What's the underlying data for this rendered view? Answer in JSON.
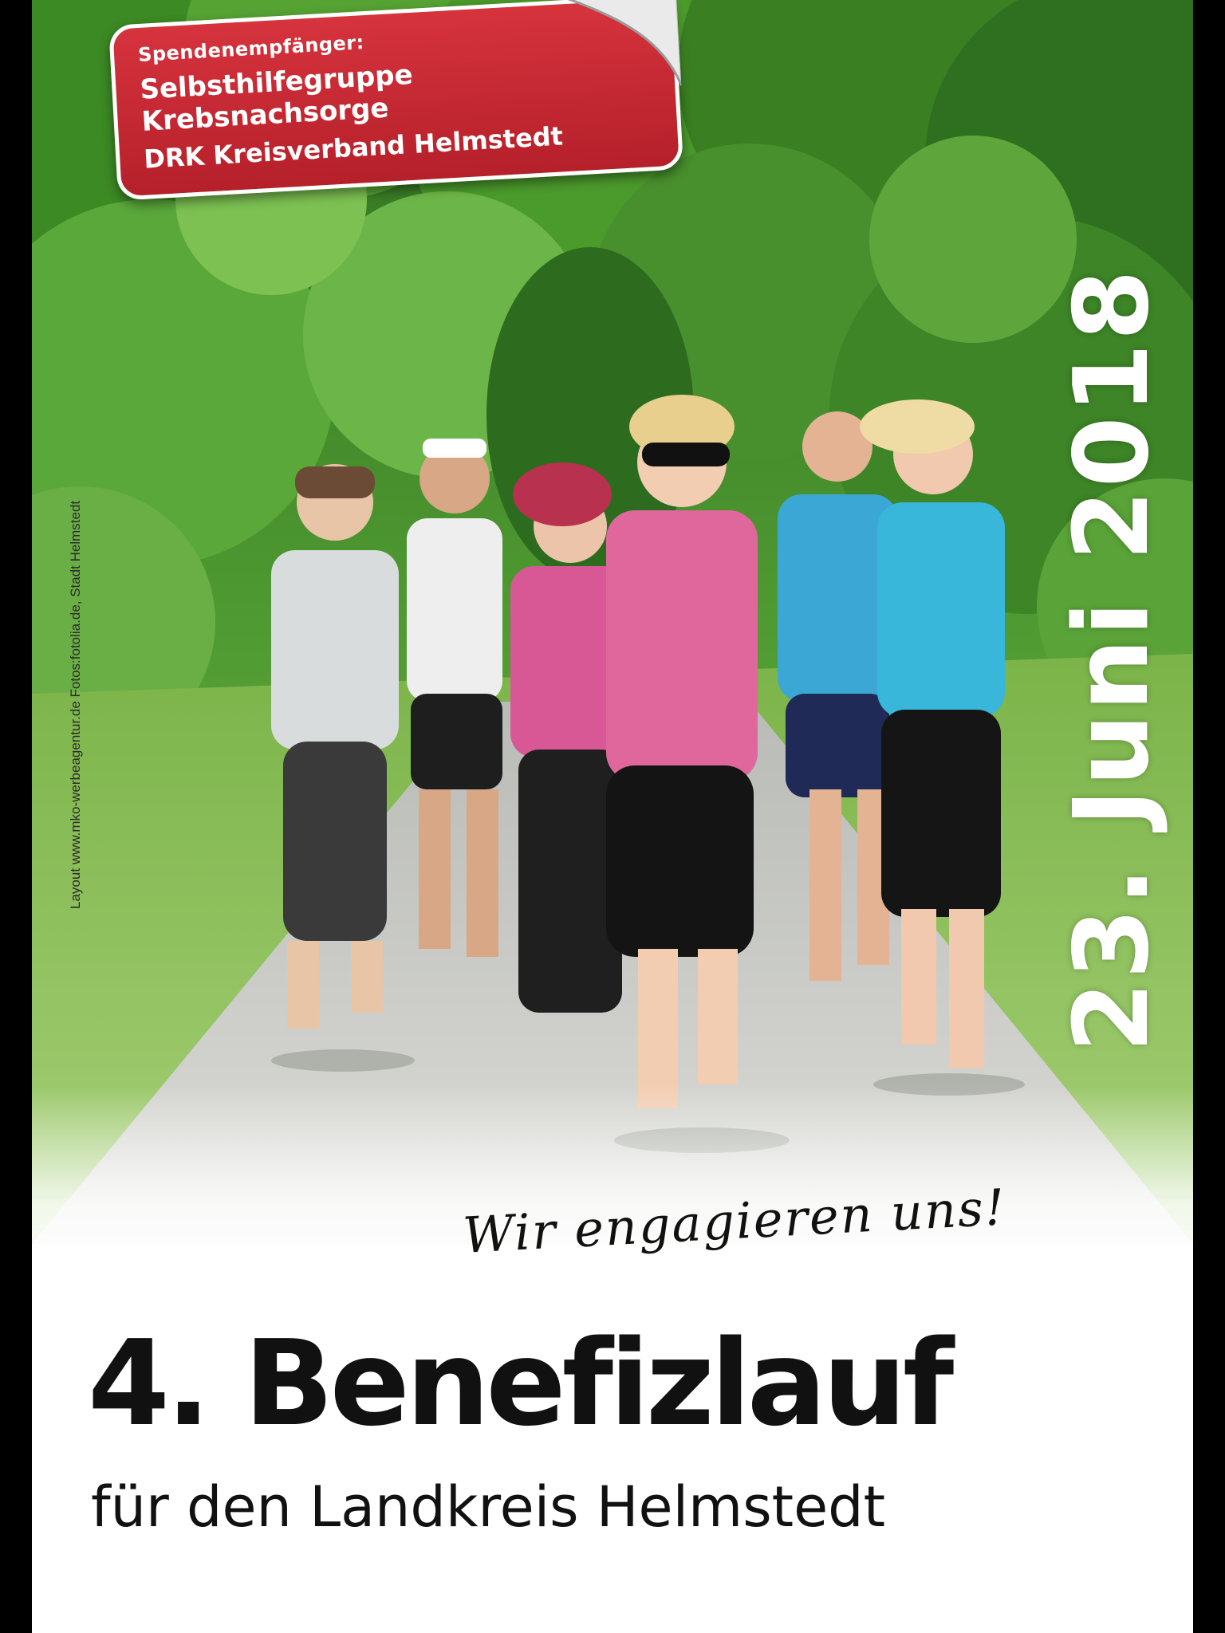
{
  "badge": {
    "label": "Spendenempfänger:",
    "line1": "Selbsthilfegruppe",
    "line2": "Krebsnachsorge",
    "line3": "DRK Kreisverband Helmstedt"
  },
  "date": "23. Juni 2018",
  "credits": "Layout www.mko-werbeagentur.de   Fotos:fotolia.de, Stadt Helmstedt",
  "slogan": "Wir engagieren uns!",
  "title": "4. Benefizlauf",
  "subtitle": "für den Landkreis Helmstedt",
  "colors": {
    "badge_red": "#c1272d",
    "text_dark": "#111111",
    "date_white": "#ffffff",
    "foliage": "#3f8a2a"
  }
}
